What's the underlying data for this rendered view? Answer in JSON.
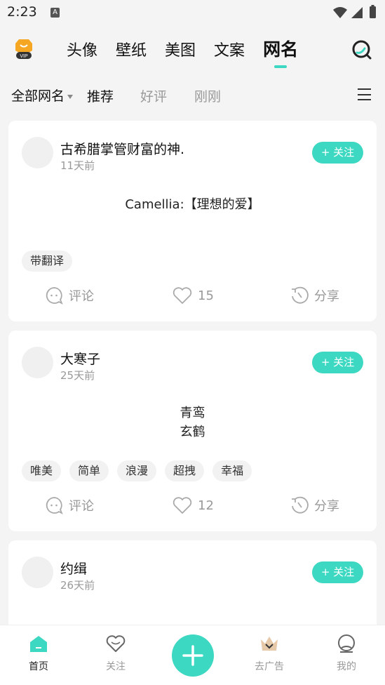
{
  "status_bar": {
    "time": "2:23",
    "notification_icon": "A"
  },
  "top_nav": {
    "tabs": [
      {
        "label": "头像"
      },
      {
        "label": "壁纸"
      },
      {
        "label": "美图"
      },
      {
        "label": "文案"
      },
      {
        "label": "网名"
      }
    ],
    "active_tab": "网名"
  },
  "sub_nav": {
    "all_label": "全部网名",
    "chips": [
      "推荐",
      "好评",
      "刚刚"
    ],
    "active_chip": "推荐"
  },
  "follow_label": "+ 关注",
  "posts": [
    {
      "username": "古希腊掌管财富的神.",
      "time": "11天前",
      "lines": [
        "Camellia:【理想的爱】"
      ],
      "tags": [
        "带翻译"
      ],
      "comment_label": "评论",
      "likes": "15",
      "share_label": "分享"
    },
    {
      "username": "大寒子",
      "time": "25天前",
      "lines": [
        "青鸾",
        "玄鹤"
      ],
      "tags": [
        "唯美",
        "简单",
        "浪漫",
        "超拽",
        "幸福"
      ],
      "comment_label": "评论",
      "likes": "12",
      "share_label": "分享"
    },
    {
      "username": "约缉",
      "time": "26天前"
    }
  ],
  "bottom_nav": [
    {
      "label": "首页",
      "icon": "home-icon"
    },
    {
      "label": "关注",
      "icon": "heart-icon"
    },
    {
      "label": "",
      "icon": "plus-icon"
    },
    {
      "label": "去广告",
      "icon": "crown-icon"
    },
    {
      "label": "我的",
      "icon": "profile-icon"
    }
  ],
  "colors": {
    "accent": "#3dd8c2",
    "vip": "#f5a623"
  }
}
